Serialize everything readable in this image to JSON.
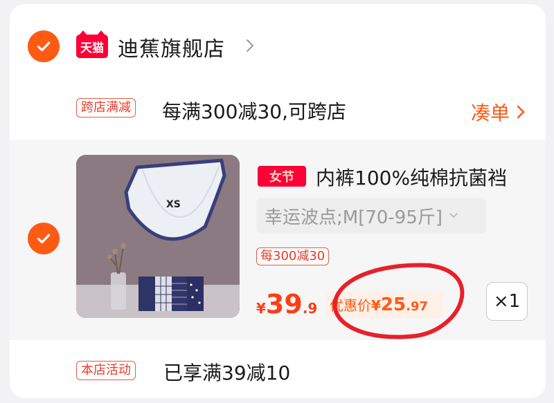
{
  "store": {
    "platform_badge": "天猫",
    "name": "迪蕉旗舰店"
  },
  "cross_store_promo": {
    "tag": "跨店满减",
    "text": "每满300减30,可跨店",
    "action_label": "凑单"
  },
  "item": {
    "event_badge": "女节",
    "title": "内裤100%纯棉抗菌裆",
    "sku": "幸运波点;M[70-95斤]",
    "discount_tag": "每300减30",
    "price": {
      "currency": "¥",
      "integer": "39",
      "decimal": ".9"
    },
    "coupon_price": {
      "label": "优惠价",
      "currency": "¥",
      "integer": "25",
      "decimal": ".97"
    },
    "quantity": "×1"
  },
  "shop_activity": {
    "tag": "本店活动",
    "text": "已享满39减10"
  },
  "colors": {
    "accent": "#ff5a14",
    "price_red": "#ff3c14",
    "tmall_red": "#ff0036",
    "annotation_red": "#e8202a"
  }
}
